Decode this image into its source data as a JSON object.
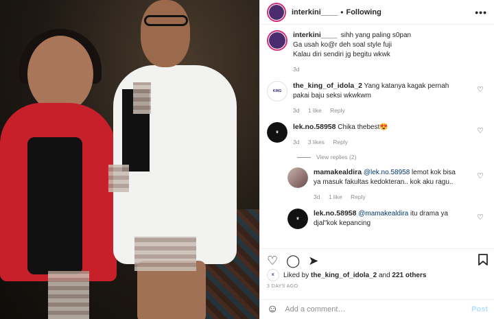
{
  "header": {
    "username": "interkini____",
    "separator": "•",
    "follow_state": "Following",
    "more_icon": "more-horizontal-icon"
  },
  "caption": {
    "username": "interkini____",
    "line1": "sihh yang paling s0pan",
    "line2": "Ga usah ko@r deh soal style fuji",
    "line3": "Kalau diri sendiri jg begitu wkwk",
    "time": "3d"
  },
  "comments": [
    {
      "username": "the_king_of_idola_2",
      "text": "Yang katanya kagak pernah pakai baju seksi wkwkwm",
      "time": "3d",
      "likes": "1 like",
      "reply": "Reply"
    },
    {
      "username": "lek.no.58958",
      "text": "Chika thebest😍",
      "time": "3d",
      "likes": "3 likes",
      "reply": "Reply",
      "view_replies": "View replies (2)"
    }
  ],
  "replies": [
    {
      "username": "mamakealdira",
      "mention": "@lek.no.58958",
      "text": "lemot kok bisa ya masuk fakultas kedokteran.. kok aku ragu..",
      "time": "3d",
      "likes": "1 like",
      "reply": "Reply"
    },
    {
      "username": "lek.no.58958",
      "mention": "@mamakealdira",
      "text": "itu drama ya djal\"kok kepancing"
    }
  ],
  "likes_line": {
    "prefix": "Liked by",
    "user": "the_king_of_idola_2",
    "middle": "and",
    "others": "221 others"
  },
  "date": "3 DAYS AGO",
  "add_comment": {
    "placeholder": "Add a comment…",
    "post_label": "Post"
  },
  "icons": {
    "like": "heart-icon",
    "comment": "comment-icon",
    "share": "share-icon",
    "save": "bookmark-icon",
    "emoji": "emoji-icon"
  },
  "colors": {
    "link": "#00376b",
    "muted": "#8e8e8e",
    "post_disabled": "#b2dffc",
    "jacket": "#c8202a"
  }
}
